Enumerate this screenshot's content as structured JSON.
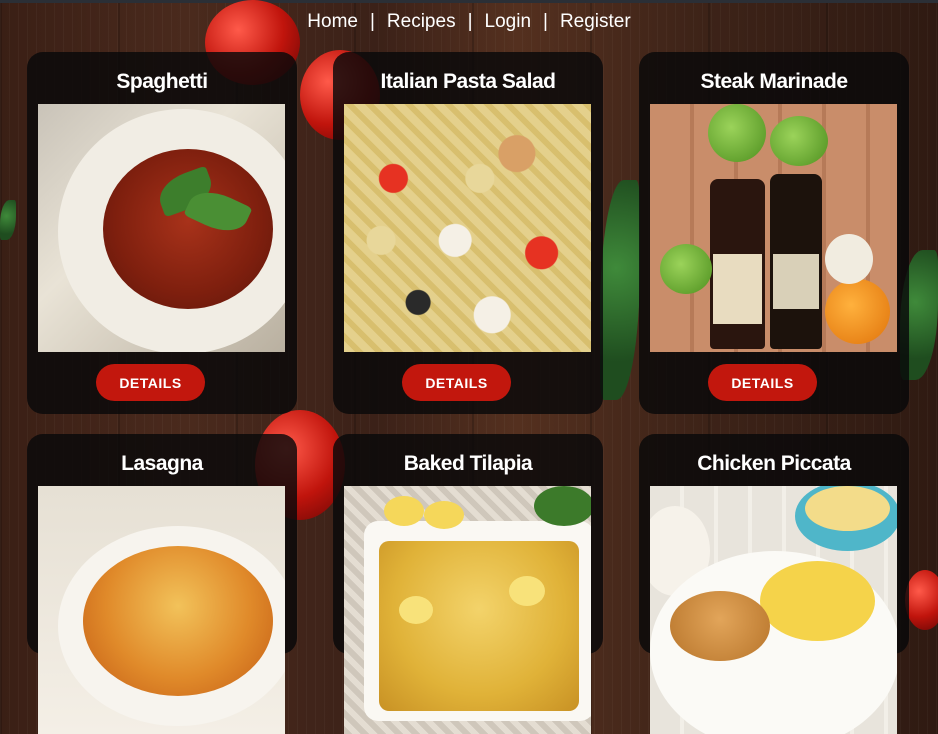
{
  "nav": {
    "items": [
      "Home",
      "Recipes",
      "Login",
      "Register"
    ],
    "separator": "|"
  },
  "recipes": [
    {
      "title": "Spaghetti",
      "button": "DETAILS"
    },
    {
      "title": "Italian Pasta Salad",
      "button": "DETAILS"
    },
    {
      "title": "Steak Marinade",
      "button": "DETAILS"
    },
    {
      "title": "Lasagna"
    },
    {
      "title": "Baked Tilapia"
    },
    {
      "title": "Chicken Piccata"
    }
  ],
  "colors": {
    "button": "#c2170d",
    "card": "#08080a",
    "text": "#ffffff"
  }
}
